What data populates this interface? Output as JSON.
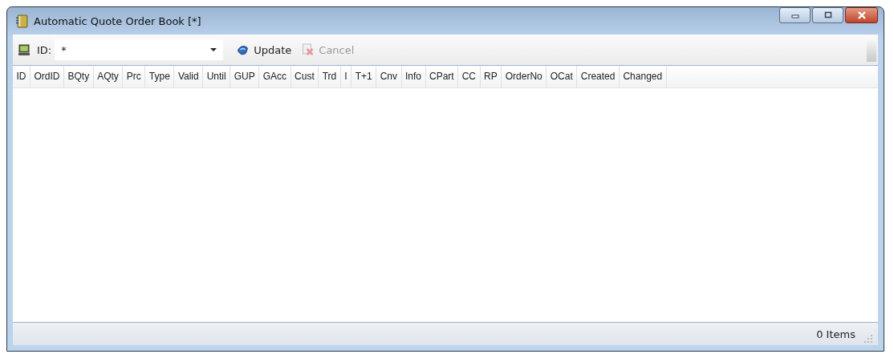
{
  "window": {
    "title": "Automatic Quote Order Book [*]"
  },
  "toolbar": {
    "id_label": "ID:",
    "id_value": "*",
    "buttons": [
      {
        "kind": "update",
        "label": "Update",
        "disabled": false
      },
      {
        "kind": "cancel",
        "label": "Cancel",
        "disabled": true
      }
    ]
  },
  "table": {
    "columns": [
      "ID",
      "OrdID",
      "BQty",
      "AQty",
      "Prc",
      "Type",
      "Valid",
      "Until",
      "GUP",
      "GAcc",
      "Cust",
      "Trd",
      "I",
      "T+1",
      "Cnv",
      "Info",
      "CPart",
      "CC",
      "RP",
      "OrderNo",
      "OCat",
      "Created",
      "Changed"
    ]
  },
  "status_bar": {
    "count": "0 Items"
  }
}
